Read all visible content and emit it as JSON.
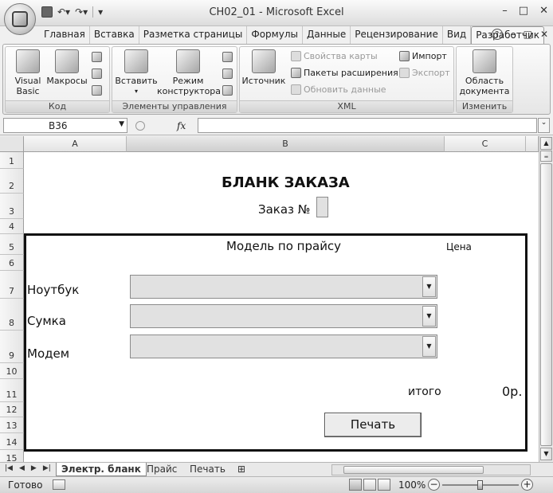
{
  "window": {
    "title": "CH02_01 - Microsoft Excel",
    "controls": [
      "–",
      "□",
      "✕"
    ]
  },
  "ribbon_tabs": [
    "Главная",
    "Вставка",
    "Разметка страницы",
    "Формулы",
    "Данные",
    "Рецензирование",
    "Вид",
    "Разработчик"
  ],
  "active_tab": "Разработчик",
  "ribbon": {
    "groups": {
      "code": {
        "label": "Код",
        "visual_basic": "Visual\nBasic",
        "macros": "Макросы"
      },
      "controls": {
        "label": "Элементы управления",
        "insert": "Вставить",
        "design_mode": "Режим\nконструктора"
      },
      "xml": {
        "label": "XML",
        "source": "Источник",
        "map_properties": "Свойства карты",
        "expansion_packs": "Пакеты расширения",
        "refresh_data": "Обновить данные",
        "import": "Импорт",
        "export": "Экспорт"
      },
      "modify": {
        "label": "Изменить",
        "document_panel": "Область\nдокумента"
      }
    }
  },
  "formula_bar": {
    "name_box": "B36",
    "fx": "fx",
    "formula": ""
  },
  "columns": [
    "A",
    "B",
    "C"
  ],
  "rows": [
    "1",
    "2",
    "3",
    "4",
    "5",
    "6",
    "7",
    "8",
    "9",
    "10",
    "11",
    "12",
    "13",
    "14",
    "15"
  ],
  "sheet": {
    "title": "БЛАНК ЗАКАЗА",
    "order_label": "Заказ №",
    "model_header": "Модель по прайсу",
    "price_header": "Цена",
    "items": [
      {
        "label": "Ноутбук",
        "selected": ""
      },
      {
        "label": "Сумка",
        "selected": ""
      },
      {
        "label": "Модем",
        "selected": ""
      }
    ],
    "total_label": "итого",
    "total_value": "0р.",
    "print_button": "Печать"
  },
  "sheet_tabs": [
    "Электр. бланк",
    "Прайс",
    "Печать"
  ],
  "active_sheet": "Электр. бланк",
  "status": {
    "ready": "Готово",
    "zoom": "100%"
  },
  "icons": {
    "office": "office-button-icon",
    "save": "save-icon",
    "undo": "undo-icon",
    "redo": "redo-icon",
    "help": "help-icon"
  }
}
